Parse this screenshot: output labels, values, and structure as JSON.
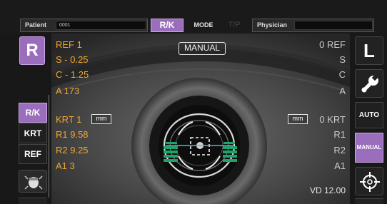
{
  "header": {
    "patient_label": "Patient",
    "patient_value": "0001",
    "rk_label": "R/K",
    "mode_label": "MODE",
    "tp_label": "T/P",
    "physician_label": "Physician",
    "physician_value": ""
  },
  "left_panel": {
    "eye_button": "R",
    "tabs": [
      "R/K",
      "KRT",
      "REF"
    ],
    "active_tab": "R/K"
  },
  "right_panel": {
    "eye_button": "L",
    "auto_label": "AUTO",
    "manual_label": "MANUAL"
  },
  "overlay": {
    "manual_badge": "MANUAL",
    "ref_right": {
      "line1": "REF  1",
      "sph": "S - 0.25",
      "cyl": "C - 1.25",
      "axis": "A 173"
    },
    "ref_left": {
      "line1": "0  REF",
      "s": "S",
      "c": "C",
      "a": "A"
    },
    "krt_right": {
      "title": "KRT  1",
      "mm": "mm",
      "r1": "R1  9.58",
      "r2": "R2  9.25",
      "a1": "A1  3"
    },
    "krt_left": {
      "mm": "mm",
      "title": "0  KRT",
      "r1": "R1",
      "r2": "R2",
      "a1": "A1"
    },
    "vd": "VD  12.00"
  },
  "colors": {
    "accent": "#9a6dbd",
    "measurement": "#f0a531",
    "alignment_marker": "#1ea36a"
  },
  "icons": [
    "wrench-icon",
    "crosshair-icon",
    "eye-face-icon"
  ]
}
